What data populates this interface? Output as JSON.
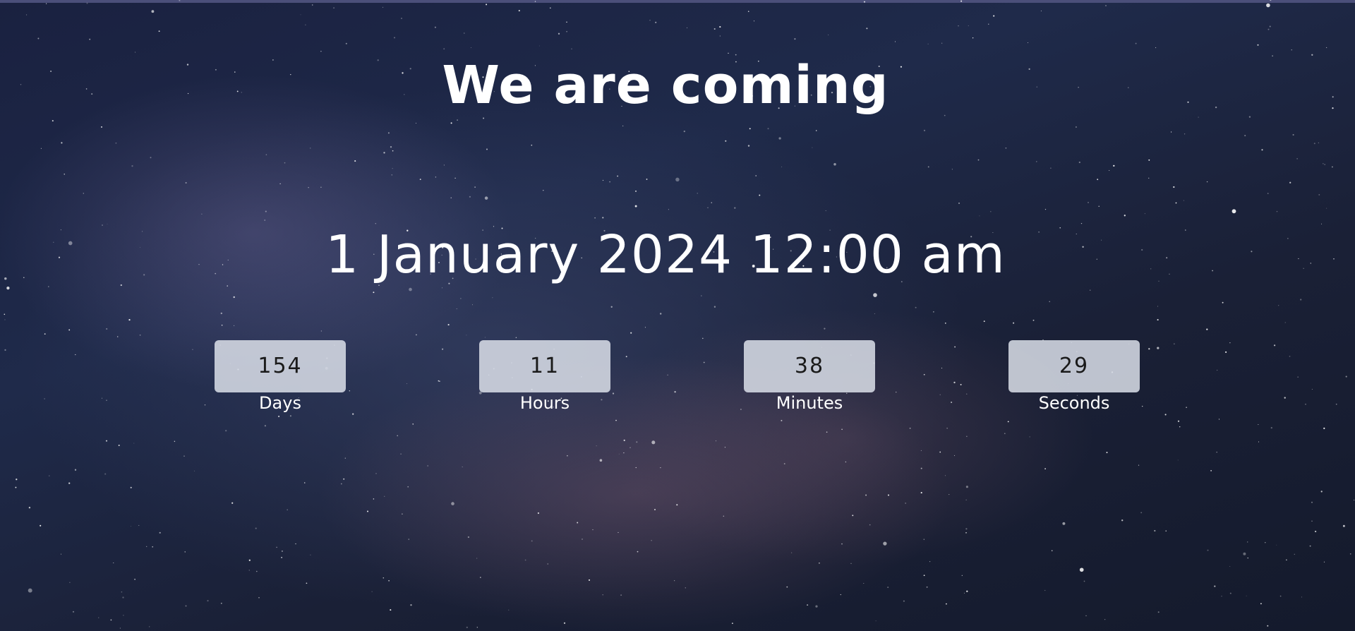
{
  "page": {
    "heading": "We are coming",
    "launch_datetime": "1 January 2024 12:00 am"
  },
  "countdown": [
    {
      "value": "154",
      "label": "Days"
    },
    {
      "value": "11",
      "label": "Hours"
    },
    {
      "value": "38",
      "label": "Minutes"
    },
    {
      "value": "29",
      "label": "Seconds"
    }
  ],
  "colors": {
    "background": "#1c2340",
    "text": "#ffffff",
    "timer_box": "#dce0ea",
    "timer_text": "#1a1a1a"
  }
}
